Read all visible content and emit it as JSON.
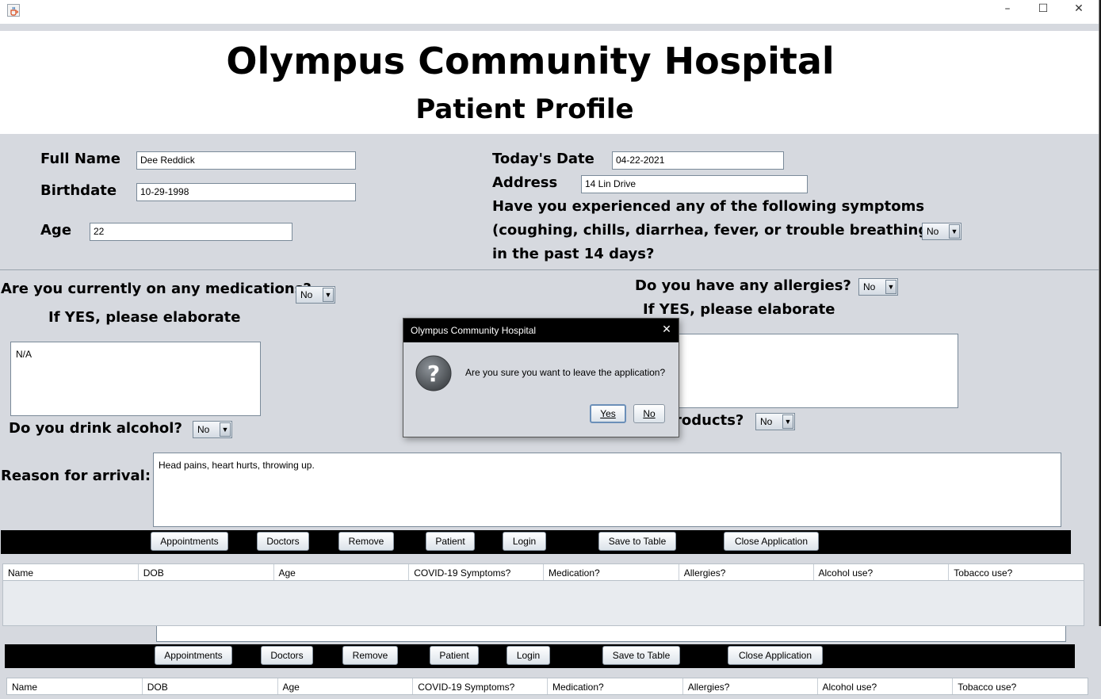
{
  "window": {
    "controls": [
      "–",
      "☐",
      "✕"
    ],
    "app_icon": "java-cup-icon"
  },
  "header": {
    "title": "Olympus Community Hospital",
    "subtitle": "Patient Profile"
  },
  "form": {
    "full_name_label": "Full Name",
    "full_name": "Dee Reddick",
    "birthdate_label": "Birthdate",
    "birthdate": "10-29-1998",
    "age_label": "Age",
    "age": "22",
    "todays_date_label": "Today's Date",
    "todays_date": "04-22-2021",
    "address_label": "Address",
    "address": "14 Lin Drive",
    "symptoms_line1": "Have you experienced any of the following symptoms",
    "symptoms_line2": "(coughing, chills, diarrhea, fever, or trouble breathing)",
    "symptoms_line3": "in the past 14 days?",
    "symptoms_value": "No",
    "medications_label": "Are you currently on any medications?",
    "medications_value": "No",
    "med_elaborate_label": "If YES, please elaborate",
    "med_elaborate": "N/A",
    "allergies_label": "Do you have any allergies?",
    "allergies_value": "No",
    "allergy_elaborate_label": "If YES, please elaborate",
    "alcohol_label": "Do you drink alcohol?",
    "alcohol_value": "No",
    "tobacco_label_partial": "roducts?",
    "tobacco_value": "No",
    "reason_label": "Reason for arrival:",
    "reason": "Head pains, heart hurts, throwing up."
  },
  "toolbar": {
    "buttons": [
      "Appointments",
      "Doctors",
      "Remove",
      "Patient",
      "Login",
      "Save to Table",
      "Close Application"
    ]
  },
  "table": {
    "columns": [
      "Name",
      "DOB",
      "Age",
      "COVID-19 Symptoms?",
      "Medication?",
      "Allergies?",
      "Alcohol use?",
      "Tobacco use?"
    ]
  },
  "dialog": {
    "title": "Olympus Community Hospital",
    "message": "Are you sure you want to leave the application?",
    "yes": "Yes",
    "no": "No",
    "icon": "question-icon"
  }
}
